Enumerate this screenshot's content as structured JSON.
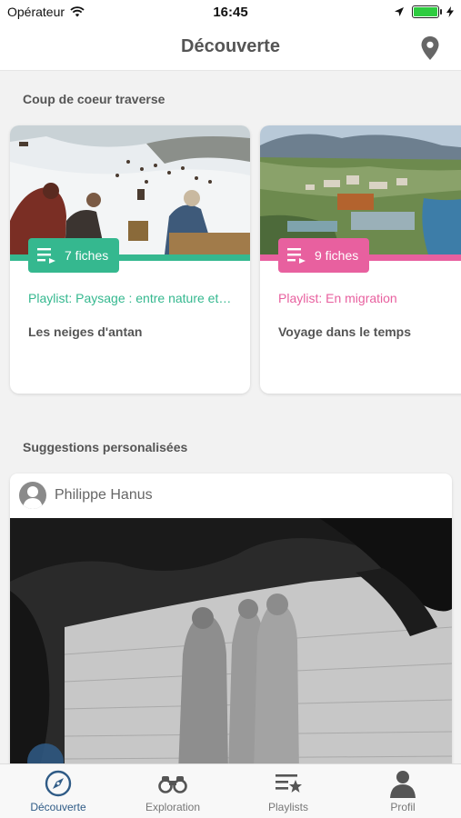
{
  "status_bar": {
    "carrier": "Opérateur",
    "time": "16:45"
  },
  "header": {
    "title": "Découverte"
  },
  "sections": {
    "featured_title": "Coup de coeur traverse",
    "suggestions_title": "Suggestions personalisées"
  },
  "featured_cards": [
    {
      "count_label": "7 fiches",
      "playlist": "Playlist: Paysage : entre nature et…",
      "name": "Les neiges d'antan",
      "accent": "#35b88f"
    },
    {
      "count_label": "9 fiches",
      "playlist": "Playlist: En migration",
      "name": "Voyage dans le temps",
      "accent": "#e8609f"
    }
  ],
  "suggestion": {
    "user": "Philippe Hanus"
  },
  "tabs": [
    {
      "label": "Découverte",
      "icon": "compass-icon",
      "active": true
    },
    {
      "label": "Exploration",
      "icon": "binoculars-icon",
      "active": false
    },
    {
      "label": "Playlists",
      "icon": "playlist-star-icon",
      "active": false
    },
    {
      "label": "Profil",
      "icon": "person-icon",
      "active": false
    }
  ],
  "colors": {
    "active_tab": "#2f5b86",
    "green_accent": "#35b88f",
    "pink_accent": "#e8609f"
  }
}
